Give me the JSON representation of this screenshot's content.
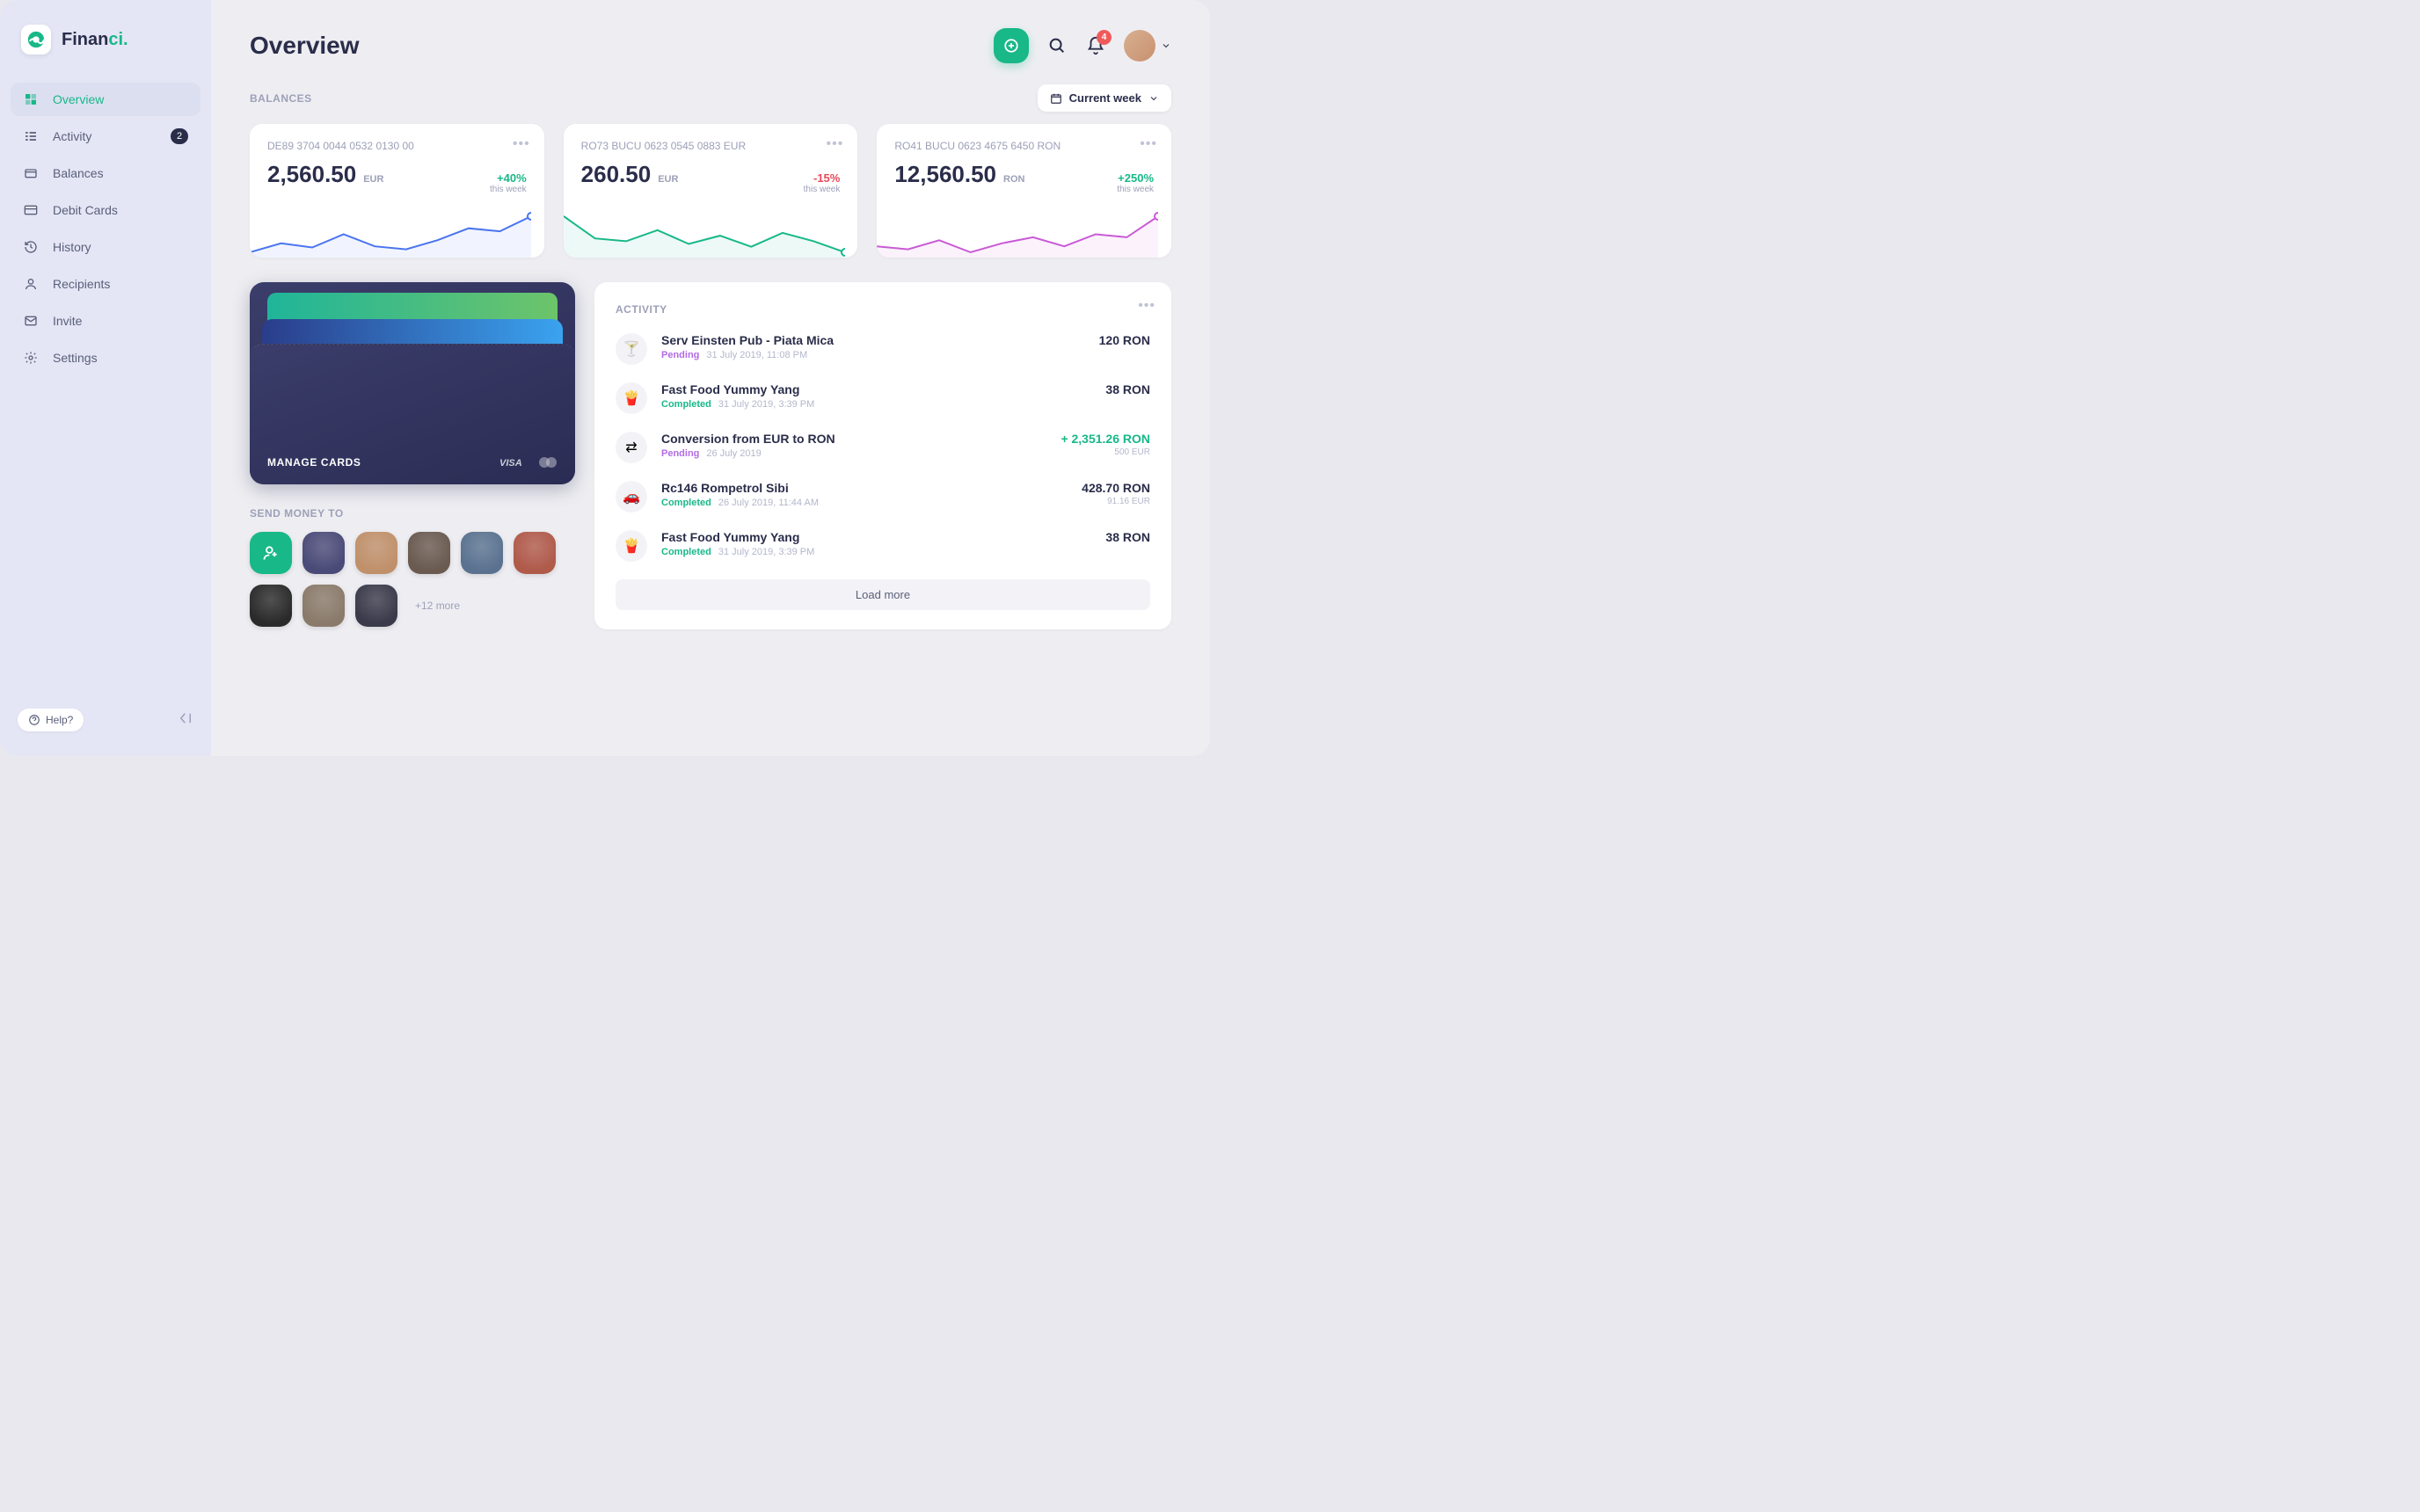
{
  "brand": {
    "pre": "Finan",
    "ci": "ci."
  },
  "sidebar": {
    "items": [
      {
        "label": "Overview",
        "icon": "grid",
        "active": true
      },
      {
        "label": "Activity",
        "icon": "list",
        "badge": "2"
      },
      {
        "label": "Balances",
        "icon": "wallet"
      },
      {
        "label": "Debit Cards",
        "icon": "card"
      },
      {
        "label": "History",
        "icon": "history"
      },
      {
        "label": "Recipients",
        "icon": "users"
      },
      {
        "label": "Invite",
        "icon": "mail"
      },
      {
        "label": "Settings",
        "icon": "gear"
      }
    ],
    "help": "Help?"
  },
  "header": {
    "title": "Overview",
    "notif_count": "4",
    "period_label": "Current week"
  },
  "sections": {
    "balances": "BALANCES",
    "activity": "ACTIVITY",
    "send": "SEND MONEY TO"
  },
  "balances": [
    {
      "account": "DE89 3704 0044 0532 0130 00",
      "amount": "2,560.50",
      "currency": "EUR",
      "change": "+40%",
      "dir": "up",
      "period": "this week",
      "color": "#4a74f0"
    },
    {
      "account": "RO73 BUCU 0623 0545 0883 EUR",
      "amount": "260.50",
      "currency": "EUR",
      "change": "-15%",
      "dir": "down",
      "period": "this week",
      "color": "#18b888"
    },
    {
      "account": "RO41 BUCU 0623 4675 6450 RON",
      "amount": "12,560.50",
      "currency": "RON",
      "change": "+250%",
      "dir": "up",
      "period": "this week",
      "color": "#c95ad6"
    }
  ],
  "wallet": {
    "label": "MANAGE CARDS"
  },
  "recipients": {
    "more": "+12 more",
    "count": 8
  },
  "activity": [
    {
      "name": "Serv Einsten Pub - Piata Mica",
      "status": "Pending",
      "status_type": "pending",
      "date": "31 July 2019, 11:08 PM",
      "amount": "120 RON",
      "icon": "🍸"
    },
    {
      "name": "Fast Food Yummy Yang",
      "status": "Completed",
      "status_type": "completed",
      "date": "31 July 2019, 3:39 PM",
      "amount": "38 RON",
      "icon": "🍟"
    },
    {
      "name": "Conversion from EUR to RON",
      "status": "Pending",
      "status_type": "pending",
      "date": "26 July 2019",
      "amount": "+ 2,351.26 RON",
      "amount_class": "plus",
      "sub": "500 EUR",
      "icon": "⇄"
    },
    {
      "name": "Rc146 Rompetrol Sibi",
      "status": "Completed",
      "status_type": "completed",
      "date": "26 July 2019, 11:44 AM",
      "amount": "428.70 RON",
      "sub": "91.16 EUR",
      "icon": "🚗"
    },
    {
      "name": "Fast Food Yummy Yang",
      "status": "Completed",
      "status_type": "completed",
      "date": "31 July 2019, 3:39 PM",
      "amount": "38 RON",
      "icon": "🍟"
    }
  ],
  "load_more": "Load more",
  "chart_data": [
    {
      "type": "line",
      "title": "DE89 balance sparkline",
      "values": [
        20,
        35,
        28,
        50,
        30,
        25,
        40,
        60,
        55,
        80
      ]
    },
    {
      "type": "line",
      "title": "RO73 EUR balance sparkline",
      "values": [
        80,
        40,
        35,
        55,
        30,
        45,
        25,
        50,
        35,
        15
      ]
    },
    {
      "type": "line",
      "title": "RO41 RON balance sparkline",
      "values": [
        35,
        30,
        45,
        25,
        40,
        50,
        35,
        55,
        50,
        85
      ]
    }
  ],
  "recipient_colors": [
    "#4a4a78",
    "#c0906a",
    "#6a5a50",
    "#5a7290",
    "#b05a4a",
    "#2a2a2a",
    "#8a7a6a",
    "#3a3a4a"
  ]
}
